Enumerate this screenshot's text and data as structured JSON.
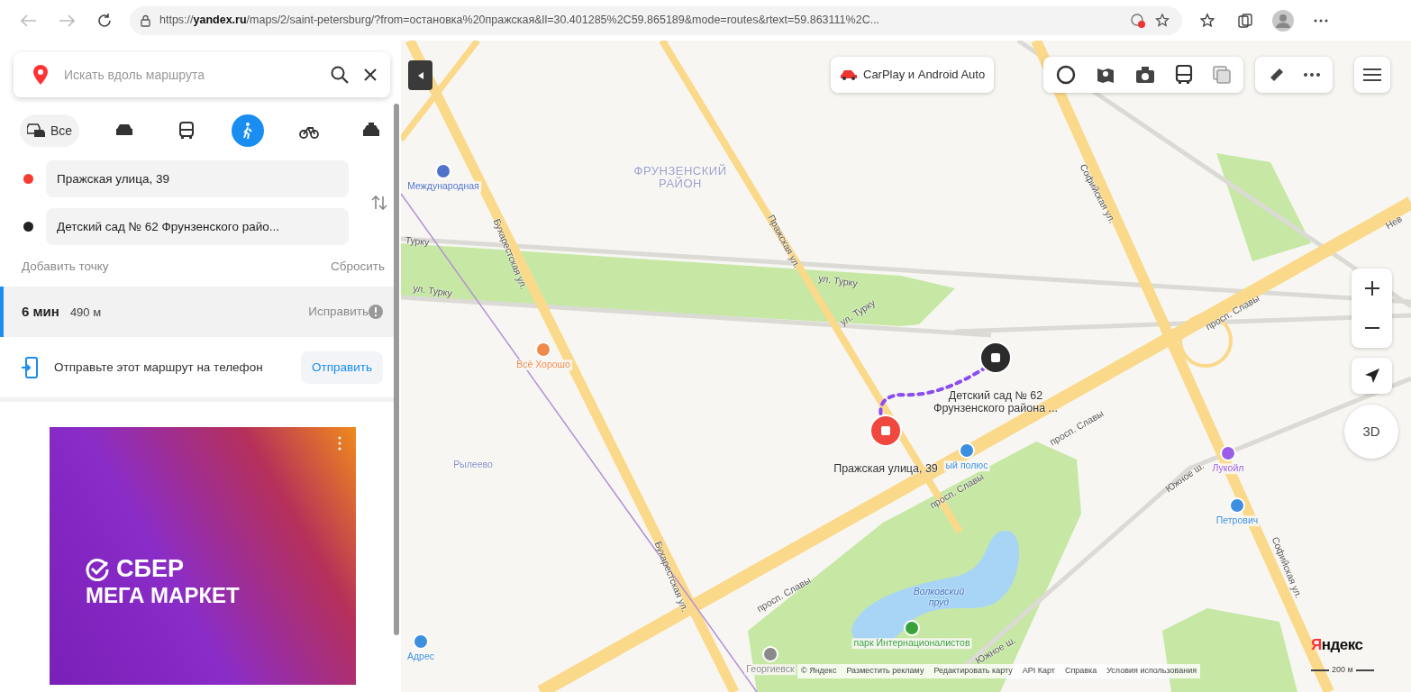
{
  "browser": {
    "url": "https://**yandex.ru**/maps/2/saint-petersburg/?from=остановка%20пражская&ll=30.401285%2C59.865189&mode=routes&rtext=59.863111%2C..."
  },
  "sidebar": {
    "search": {
      "placeholder": "Искать вдоль маршрута"
    },
    "modes": [
      {
        "kind": "all",
        "label": "Все",
        "selected": false
      },
      {
        "kind": "car",
        "selected": false
      },
      {
        "kind": "bus",
        "selected": false
      },
      {
        "kind": "walk",
        "selected": true
      },
      {
        "kind": "bike",
        "selected": false
      },
      {
        "kind": "taxi",
        "selected": false
      }
    ],
    "route_points": [
      {
        "value": "Пражская улица, 39",
        "color": "#f43b2f"
      },
      {
        "value": "Детский сад № 62 Фрунзенского райо...",
        "color": "#222222"
      }
    ],
    "add_point": "Добавить точку",
    "reset": "Сбросить",
    "route": {
      "time": "6 мин",
      "distance": "490 м",
      "fix": "Исправить",
      "selected": true
    },
    "send": {
      "text": "Отправьте этот маршрут на телефон",
      "button": "Отправить"
    },
    "ad": {
      "brand_top": "СБЕР",
      "brand_bottom": "МЕГА МАРКЕТ"
    }
  },
  "map": {
    "carplay": "CarPlay и Android Auto",
    "labels": [
      {
        "kind": "district",
        "text": "ФРУНЗЕНСКИЙ РАЙОН"
      },
      {
        "kind": "street",
        "text": "Бухарестская ул."
      },
      {
        "kind": "street",
        "text": "Бухарестская ул."
      },
      {
        "kind": "street",
        "text": "Пражская ул."
      },
      {
        "kind": "street",
        "text": "Турку"
      },
      {
        "kind": "street",
        "text": "ул. Турку"
      },
      {
        "kind": "street",
        "text": "ул. Турку"
      },
      {
        "kind": "street",
        "text": "ул. Турку"
      },
      {
        "kind": "street",
        "text": "Софийская ул."
      },
      {
        "kind": "street",
        "text": "Софийская ул."
      },
      {
        "kind": "street",
        "text": "просп. Славы"
      },
      {
        "kind": "street",
        "text": "просп. Славы"
      },
      {
        "kind": "street",
        "text": "просп. Славы"
      },
      {
        "kind": "street",
        "text": "просп. Славы"
      },
      {
        "kind": "street",
        "text": "Южное ш."
      },
      {
        "kind": "street",
        "text": "Южное ш."
      },
      {
        "kind": "street",
        "text": "Нев"
      },
      {
        "kind": "water",
        "text": "Волковский пруд"
      },
      {
        "kind": "place",
        "text": "Рылеево"
      }
    ],
    "pois": [
      {
        "text": "Международная",
        "color": "#4f73c9"
      },
      {
        "text": "Всё Хорошо",
        "color": "#f08a4b"
      },
      {
        "text": "ый полюс",
        "color": "#3d8fe0"
      },
      {
        "text": "Лукойл",
        "color": "#9b5de5"
      },
      {
        "text": "Петрович",
        "color": "#3d8fe0"
      },
      {
        "text": "Адрес",
        "color": "#3d8fe0"
      },
      {
        "text": "парк Интернационалистов",
        "color": "#38a33a"
      },
      {
        "text": "Георгиевск",
        "color": "#8a8a8a"
      }
    ],
    "markers": [
      {
        "kind": "start",
        "label": "Пражская улица, 39"
      },
      {
        "kind": "finish",
        "label": "Детский сад № 62 Фрунзенского района ..."
      }
    ],
    "button_3d": "3D",
    "footer": {
      "links": [
        "© Яндекс",
        "Разместить рекламу",
        "Редактировать карту",
        "API Карт",
        "Справка",
        "Условия использования"
      ],
      "scale": "200 м",
      "logo": "Яндекс"
    }
  }
}
